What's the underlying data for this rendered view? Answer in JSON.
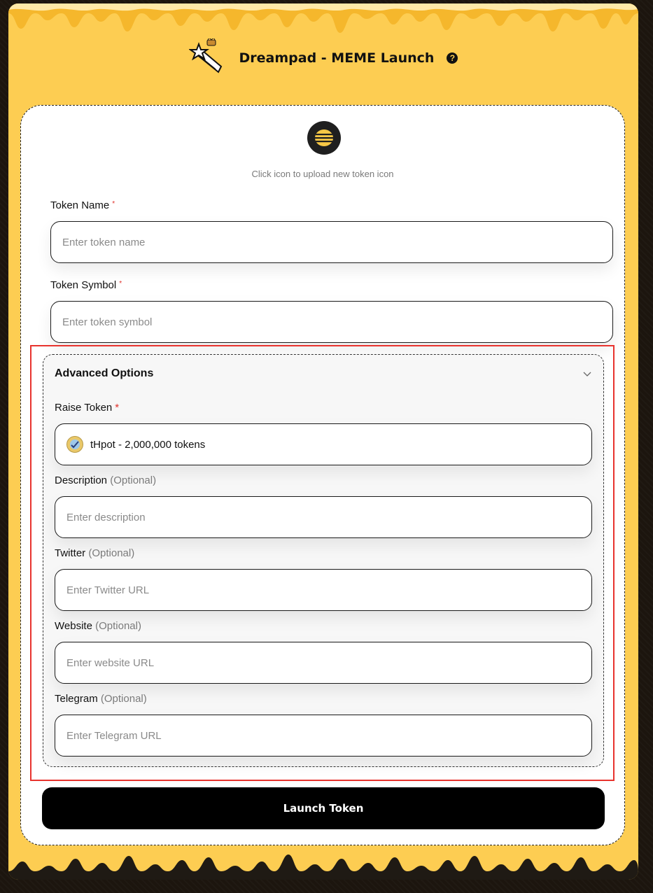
{
  "header": {
    "title": "Dreampad - MEME Launch",
    "help_icon": "question-circle-icon",
    "logo": "shooting-star-icon"
  },
  "card": {
    "upload_hint": "Click icon to upload new token icon",
    "token_icon": "beehive-icon"
  },
  "token_name": {
    "label": "Token Name",
    "required_mark": "*",
    "placeholder": "Enter token name",
    "value": ""
  },
  "token_symbol": {
    "label": "Token Symbol",
    "required_mark": "*",
    "placeholder": "Enter token symbol",
    "value": ""
  },
  "advanced": {
    "title": "Advanced Options",
    "expanded": true,
    "raise_token": {
      "label": "Raise Token",
      "required_mark": "*",
      "selected": "tHpot - 2,000,000 tokens"
    },
    "description": {
      "label": "Description",
      "optional": "(Optional)",
      "placeholder": "Enter description"
    },
    "twitter": {
      "label": "Twitter",
      "optional": "(Optional)",
      "placeholder": "Enter Twitter URL"
    },
    "website": {
      "label": "Website",
      "optional": "(Optional)",
      "placeholder": "Enter website URL"
    },
    "telegram": {
      "label": "Telegram",
      "optional": "(Optional)",
      "placeholder": "Enter Telegram URL"
    }
  },
  "launch_label": "Launch Token",
  "colors": {
    "panel": "#fdcd52",
    "drip_bottom": "#1f1a14",
    "highlight": "#e8332e",
    "required": "#e0322c",
    "button": "#000000"
  }
}
